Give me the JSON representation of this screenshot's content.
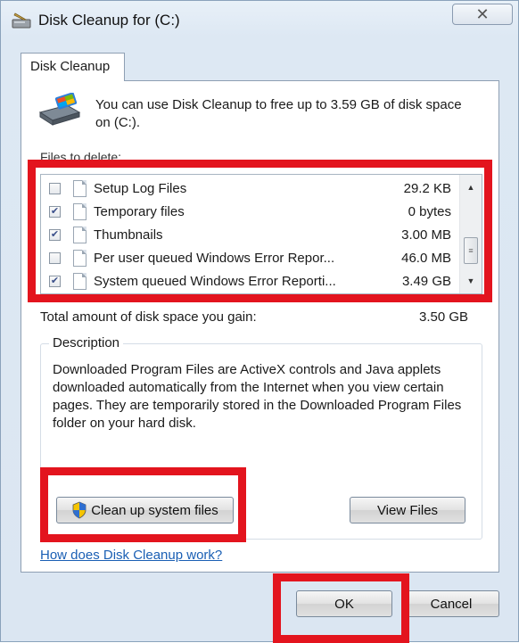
{
  "window": {
    "title": "Disk Cleanup for  (C:)",
    "close_glyph": "✕",
    "icon": "disk-cleanup-icon"
  },
  "tab": {
    "label": "Disk Cleanup"
  },
  "intro": {
    "text": "You can use Disk Cleanup to free up to 3.59 GB of disk space on  (C:).",
    "icon": "drive-broom-icon"
  },
  "files_to_delete": {
    "label": "Files to delete:",
    "items": [
      {
        "name": "Setup Log Files",
        "size": "29.2 KB",
        "checked": false
      },
      {
        "name": "Temporary files",
        "size": "0 bytes",
        "checked": true
      },
      {
        "name": "Thumbnails",
        "size": "3.00 MB",
        "checked": true
      },
      {
        "name": "Per user queued Windows Error Repor...",
        "size": "46.0 MB",
        "checked": false
      },
      {
        "name": "System queued Windows Error Reporti...",
        "size": "3.49 GB",
        "checked": true
      }
    ]
  },
  "total": {
    "label": "Total amount of disk space you gain:",
    "value": "3.50 GB"
  },
  "description": {
    "title": "Description",
    "text": "Downloaded Program Files are ActiveX controls and Java applets downloaded automatically from the Internet when you view certain pages. They are temporarily stored in the Downloaded Program Files folder on your hard disk."
  },
  "buttons": {
    "clean_up": "Clean up system files",
    "view_files": "View Files",
    "ok": "OK",
    "cancel": "Cancel"
  },
  "help_link": "How does Disk Cleanup work?",
  "colors": {
    "highlight": "#e3141e",
    "link": "#1a5fb4"
  }
}
